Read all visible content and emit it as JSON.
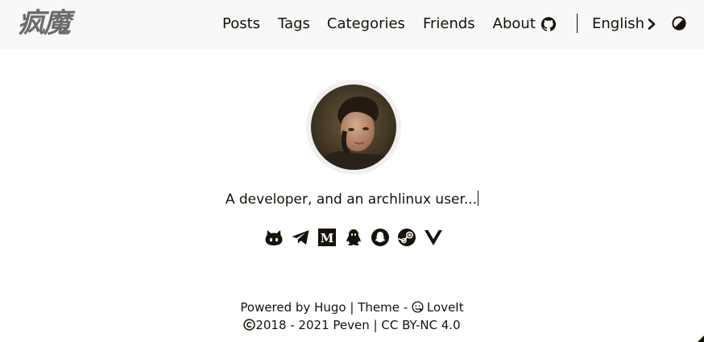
{
  "header": {
    "logo_text": "疯魔",
    "menu": [
      {
        "label": "Posts"
      },
      {
        "label": "Tags"
      },
      {
        "label": "Categories"
      },
      {
        "label": "Friends"
      },
      {
        "label": "About"
      }
    ],
    "github_icon": "github-icon",
    "language_label": "English",
    "theme_icon": "theme-switch-icon"
  },
  "home": {
    "subtitle": "A developer, and an archlinux user...",
    "social_icons": [
      "github-icon",
      "telegram-icon",
      "medium-icon",
      "qq-icon",
      "snapchat-icon",
      "steam-icon",
      "vuejs-icon"
    ]
  },
  "footer": {
    "powered_prefix": "Powered by",
    "hugo_label": "Hugo",
    "theme_sep": "| Theme -",
    "theme_label": "LoveIt",
    "copyright_years": "2018 - 2021",
    "author": "Peven",
    "license_sep": "|",
    "license": "CC BY-NC 4.0"
  },
  "colors": {
    "text": "#161209",
    "header_bg": "#f8f8f8",
    "logo": "#6b6b6b",
    "avatar_ring": "#f0f0f0"
  }
}
